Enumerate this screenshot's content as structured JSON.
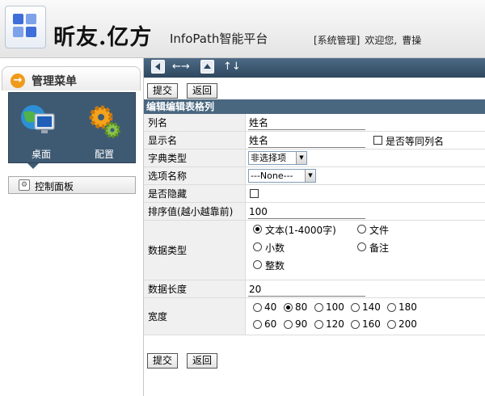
{
  "header": {
    "brand": "昕友.亿方",
    "platform": "InfoPath智能平台",
    "role": "[系统管理]",
    "welcome": "欢迎您,",
    "user": "曹操"
  },
  "toolbar": {
    "arrows_lr": "←→",
    "arrows_ud": "↑↓"
  },
  "sidebar": {
    "title": "管理菜单",
    "modules": [
      {
        "label": "桌面"
      },
      {
        "label": "配置"
      }
    ],
    "items": [
      {
        "label": "控制面板"
      }
    ]
  },
  "form": {
    "submit_label": "提交",
    "back_label": "返回",
    "section_title": "编辑编辑表格列",
    "fields": {
      "column_name": {
        "label": "列名",
        "value": "姓名"
      },
      "display_name": {
        "label": "显示名",
        "value": "姓名",
        "same_as_label": "是否等同列名"
      },
      "dict_type": {
        "label": "字典类型",
        "value": "非选择项"
      },
      "option_name": {
        "label": "选项名称",
        "value": "---None---"
      },
      "hidden": {
        "label": "是否隐藏"
      },
      "sort_order": {
        "label": "排序值(越小越靠前)",
        "value": "100"
      },
      "data_type": {
        "label": "数据类型",
        "options": [
          "文本(1-4000字)",
          "文件",
          "小数",
          "备注",
          "整数"
        ],
        "selected": "文本(1-4000字)"
      },
      "data_length": {
        "label": "数据长度",
        "value": "20"
      },
      "width": {
        "label": "宽度",
        "options": [
          "40",
          "80",
          "100",
          "140",
          "180",
          "60",
          "90",
          "120",
          "160",
          "200"
        ],
        "selected": "80"
      }
    }
  },
  "colors": {
    "toolbar": "#3b566f",
    "section": "#4a6780",
    "menu_accent": "#f09a1a"
  }
}
